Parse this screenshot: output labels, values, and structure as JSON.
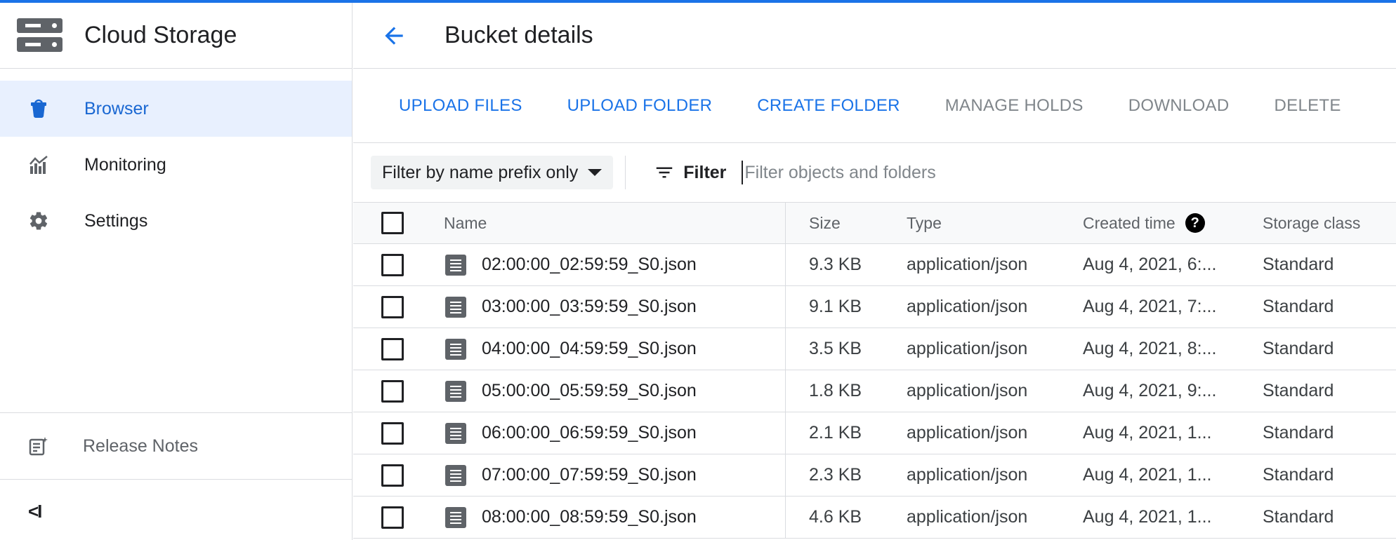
{
  "app": {
    "title": "Cloud Storage"
  },
  "colors": {
    "accent": "#1a73e8",
    "active_bg": "#e8f0fe",
    "icon_gray": "#5f6368"
  },
  "sidebar": {
    "product_icon": "storage-icon",
    "items": [
      {
        "label": "Browser",
        "icon": "bucket-icon",
        "active": true
      },
      {
        "label": "Monitoring",
        "icon": "chart-icon",
        "active": false
      },
      {
        "label": "Settings",
        "icon": "gear-icon",
        "active": false
      }
    ],
    "release_notes": {
      "label": "Release Notes",
      "icon": "notes-icon"
    },
    "collapse_label": "<I"
  },
  "header": {
    "back_icon": "arrow-back-icon",
    "title": "Bucket details"
  },
  "toolbar": {
    "upload_files": "UPLOAD FILES",
    "upload_folder": "UPLOAD FOLDER",
    "create_folder": "CREATE FOLDER",
    "manage_holds": "MANAGE HOLDS",
    "download": "DOWNLOAD",
    "delete": "DELETE"
  },
  "filter": {
    "prefix_select": "Filter by name prefix only",
    "filter_label": "Filter",
    "placeholder": "Filter objects and folders"
  },
  "table": {
    "columns": {
      "name": "Name",
      "size": "Size",
      "type": "Type",
      "created": "Created time",
      "created_help": "?",
      "class": "Storage class"
    },
    "rows": [
      {
        "name": "02:00:00_02:59:59_S0.json",
        "size": "9.3 KB",
        "type": "application/json",
        "created": "Aug 4, 2021, 6:...",
        "class": "Standard"
      },
      {
        "name": "03:00:00_03:59:59_S0.json",
        "size": "9.1 KB",
        "type": "application/json",
        "created": "Aug 4, 2021, 7:...",
        "class": "Standard"
      },
      {
        "name": "04:00:00_04:59:59_S0.json",
        "size": "3.5 KB",
        "type": "application/json",
        "created": "Aug 4, 2021, 8:...",
        "class": "Standard"
      },
      {
        "name": "05:00:00_05:59:59_S0.json",
        "size": "1.8 KB",
        "type": "application/json",
        "created": "Aug 4, 2021, 9:...",
        "class": "Standard"
      },
      {
        "name": "06:00:00_06:59:59_S0.json",
        "size": "2.1 KB",
        "type": "application/json",
        "created": "Aug 4, 2021, 1...",
        "class": "Standard"
      },
      {
        "name": "07:00:00_07:59:59_S0.json",
        "size": "2.3 KB",
        "type": "application/json",
        "created": "Aug 4, 2021, 1...",
        "class": "Standard"
      },
      {
        "name": "08:00:00_08:59:59_S0.json",
        "size": "4.6 KB",
        "type": "application/json",
        "created": "Aug 4, 2021, 1...",
        "class": "Standard"
      }
    ]
  }
}
